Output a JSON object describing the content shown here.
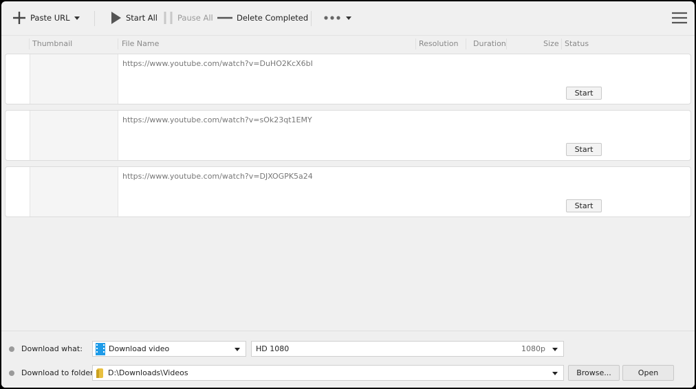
{
  "toolbar": {
    "paste_url": "Paste URL",
    "start_all": "Start All",
    "pause_all": "Pause All",
    "delete_completed": "Delete Completed"
  },
  "columns": {
    "thumbnail": "Thumbnail",
    "file_name": "File Name",
    "resolution": "Resolution",
    "duration": "Duration",
    "size": "Size",
    "status": "Status"
  },
  "rows": [
    {
      "url": "https://www.youtube.com/watch?v=DuHO2KcX6bI",
      "action": "Start"
    },
    {
      "url": "https://www.youtube.com/watch?v=sOk23qt1EMY",
      "action": "Start"
    },
    {
      "url": "https://www.youtube.com/watch?v=DJXOGPK5a24",
      "action": "Start"
    }
  ],
  "bottom": {
    "download_what_label": "Download what:",
    "download_what_value": "Download video",
    "quality_value": "HD 1080",
    "quality_tag": "1080p",
    "folder_label": "Download to folder:",
    "folder_value": "D:\\Downloads\\Videos",
    "browse": "Browse...",
    "open": "Open"
  },
  "colors": {
    "video_icon": "#1e9be8",
    "folder_icon": "#e8c040"
  }
}
